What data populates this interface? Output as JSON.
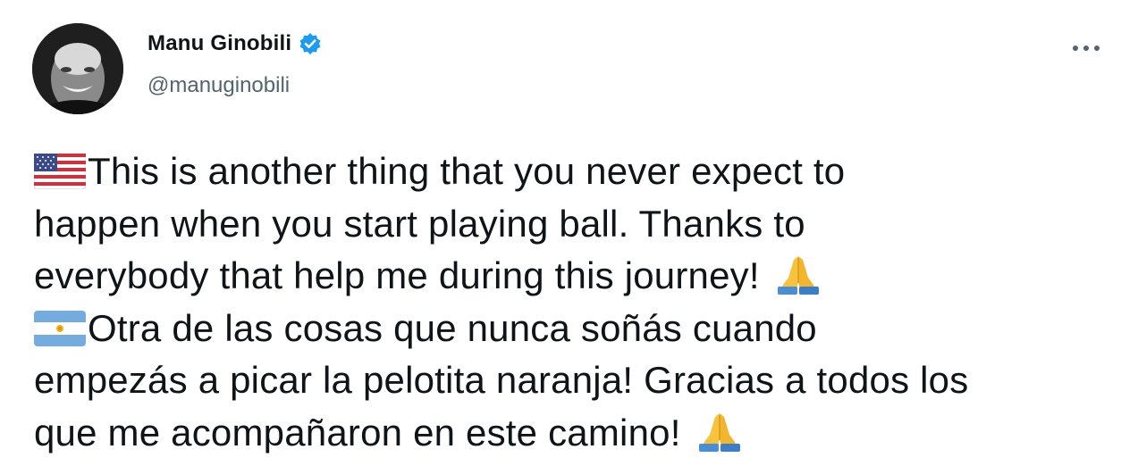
{
  "author": {
    "display_name": "Manu Ginobili",
    "handle": "@manuginobili",
    "verified": true,
    "verified_color": "#1d9bf0"
  },
  "menu": {
    "icon": "more-horizontal-icon"
  },
  "tweet": {
    "paragraph_en": {
      "flag": "us-flag-emoji",
      "lines": [
        "This is another thing that you never expect to",
        "happen when you start playing ball. Thanks to",
        "everybody that help me during this journey!"
      ],
      "trailing_emoji": "folded-hands-emoji"
    },
    "paragraph_es": {
      "flag": "argentina-flag-emoji",
      "lines": [
        "Otra de las cosas que nunca soñás cuando",
        "empezás a picar la pelotita naranja! Gracias a todos los",
        "que me acompañaron en este camino!"
      ],
      "trailing_emoji": "folded-hands-emoji"
    }
  }
}
